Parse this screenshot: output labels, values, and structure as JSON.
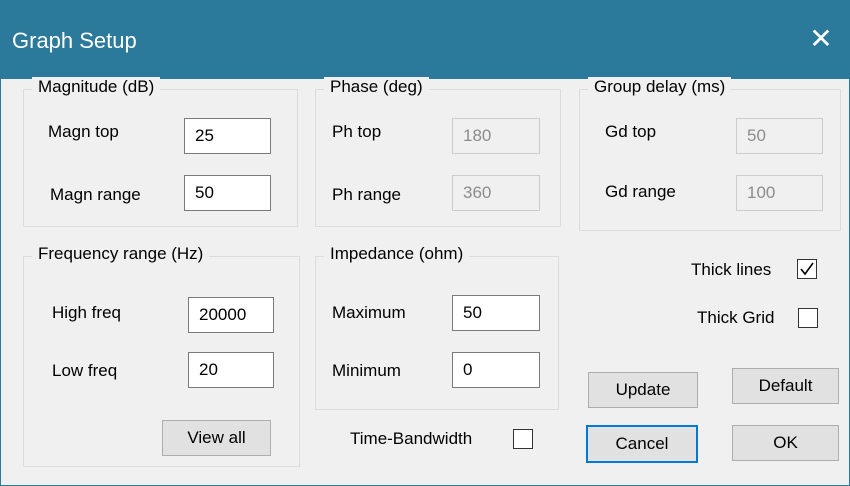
{
  "window": {
    "title": "Graph Setup",
    "close_glyph": "✕"
  },
  "magnitude": {
    "legend": "Magnitude (dB)",
    "top_label": "Magn top",
    "top_value": "25",
    "range_label": "Magn range",
    "range_value": "50"
  },
  "phase": {
    "legend": "Phase (deg)",
    "top_label": "Ph top",
    "top_value": "180",
    "range_label": "Ph range",
    "range_value": "360"
  },
  "group_delay": {
    "legend": "Group delay (ms)",
    "top_label": "Gd top",
    "top_value": "50",
    "range_label": "Gd range",
    "range_value": "100"
  },
  "frequency": {
    "legend": "Frequency range (Hz)",
    "high_label": "High freq",
    "high_value": "20000",
    "low_label": "Low freq",
    "low_value": "20",
    "view_all_label": "View all"
  },
  "impedance": {
    "legend": "Impedance (ohm)",
    "max_label": "Maximum",
    "max_value": "50",
    "min_label": "Minimum",
    "min_value": "0"
  },
  "options": {
    "thick_lines_label": "Thick lines",
    "thick_lines_checked": true,
    "thick_grid_label": "Thick Grid",
    "thick_grid_checked": false,
    "time_bandwidth_label": "Time-Bandwidth",
    "time_bandwidth_checked": false
  },
  "buttons": {
    "update": "Update",
    "default": "Default",
    "cancel": "Cancel",
    "ok": "OK"
  },
  "colors": {
    "titlebar": "#2b7a9b",
    "background": "#f0f0f0",
    "focus_border": "#0078d7"
  },
  "icons": {
    "close": "close-icon",
    "check": "checkmark-icon"
  }
}
